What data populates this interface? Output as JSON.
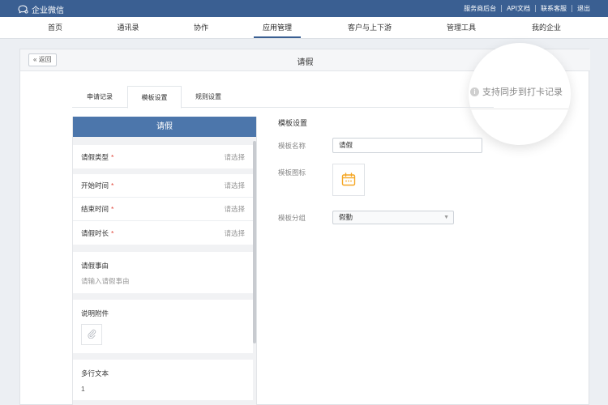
{
  "topbar": {
    "brand": "企业微信",
    "links": [
      "服务商后台",
      "API文档",
      "联系客服",
      "退出"
    ]
  },
  "nav": {
    "items": [
      "首页",
      "通讯录",
      "协作",
      "应用管理",
      "客户与上下游",
      "管理工具",
      "我的企业"
    ],
    "active": "应用管理"
  },
  "header": {
    "back_label": "« 返回",
    "title": "请假"
  },
  "tabs": {
    "items": [
      "申请记录",
      "模板设置",
      "规则设置"
    ],
    "active": "模板设置"
  },
  "sync": {
    "info_glyph": "i",
    "label": "支持同步到打卡记录"
  },
  "preview": {
    "title": "请假",
    "required_mark": "*",
    "fields": [
      {
        "label": "请假类型",
        "placeholder": "请选择"
      },
      {
        "label": "开始时间",
        "placeholder": "请选择"
      },
      {
        "label": "结束时间",
        "placeholder": "请选择"
      },
      {
        "label": "请假时长",
        "placeholder": "请选择"
      }
    ],
    "reason_title": "请假事由",
    "reason_placeholder": "请输入请假事由",
    "attachment_title": "说明附件",
    "multiline_title": "多行文本",
    "multiline_value": "1"
  },
  "settings": {
    "title": "模板设置",
    "name_label": "模板名称",
    "name_value": "请假",
    "icon_label": "模板图标",
    "icon": "calendar-icon",
    "group_label": "模板分组",
    "group_value": "假勤"
  },
  "colors": {
    "topbar": "#3a5f92",
    "preview_header": "#4c76ab",
    "required": "#e0463a",
    "calendar_icon": "#f5a623"
  }
}
